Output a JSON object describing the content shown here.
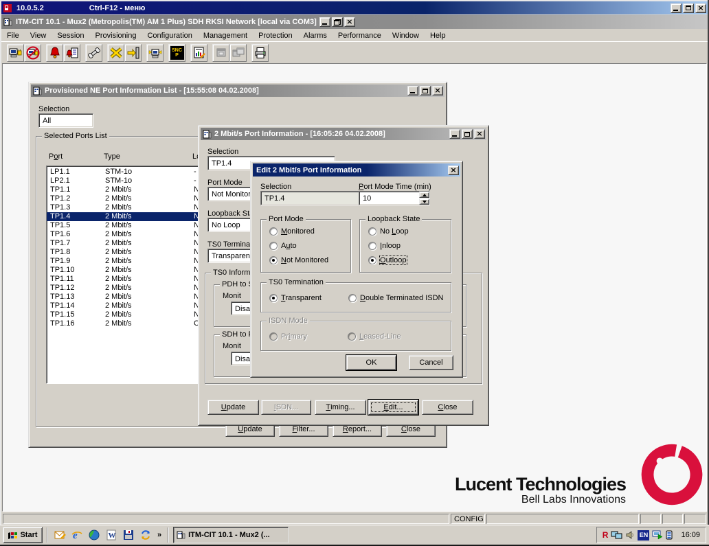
{
  "remote": {
    "ip": "10.0.5.2",
    "hint": "Ctrl-F12 - меню"
  },
  "app": {
    "title": "ITM-CIT 10.1 - Mux2 (Metropolis(TM) AM 1 Plus) SDH RKSI Network [local via COM3]"
  },
  "menu": {
    "items": [
      "File",
      "View",
      "Session",
      "Provisioning",
      "Configuration",
      "Management",
      "Protection",
      "Alarms",
      "Performance",
      "Window",
      "Help"
    ]
  },
  "toolbar": {
    "sncp_line1": "SNC",
    "sncp_line2": "P"
  },
  "window_a": {
    "title": "Provisioned NE Port Information List - [15:55:08 04.02.2008]",
    "selection_label": "Selection",
    "selection_value": "All",
    "group_label": "Selected Ports List",
    "col_port": "P&ort",
    "col_type": "Type",
    "col_state": "Lo",
    "ports": [
      {
        "port": "LP1.1",
        "type": "STM-1o",
        "state": "-"
      },
      {
        "port": "LP2.1",
        "type": "STM-1o",
        "state": "-"
      },
      {
        "port": "TP1.1",
        "type": "2 Mbit/s",
        "state": "N"
      },
      {
        "port": "TP1.2",
        "type": "2 Mbit/s",
        "state": "N"
      },
      {
        "port": "TP1.3",
        "type": "2 Mbit/s",
        "state": "N"
      },
      {
        "port": "TP1.4",
        "type": "2 Mbit/s",
        "state": "N",
        "selected": true
      },
      {
        "port": "TP1.5",
        "type": "2 Mbit/s",
        "state": "N"
      },
      {
        "port": "TP1.6",
        "type": "2 Mbit/s",
        "state": "N"
      },
      {
        "port": "TP1.7",
        "type": "2 Mbit/s",
        "state": "N"
      },
      {
        "port": "TP1.8",
        "type": "2 Mbit/s",
        "state": "N"
      },
      {
        "port": "TP1.9",
        "type": "2 Mbit/s",
        "state": "N"
      },
      {
        "port": "TP1.10",
        "type": "2 Mbit/s",
        "state": "N"
      },
      {
        "port": "TP1.11",
        "type": "2 Mbit/s",
        "state": "N"
      },
      {
        "port": "TP1.12",
        "type": "2 Mbit/s",
        "state": "N"
      },
      {
        "port": "TP1.13",
        "type": "2 Mbit/s",
        "state": "N"
      },
      {
        "port": "TP1.14",
        "type": "2 Mbit/s",
        "state": "N"
      },
      {
        "port": "TP1.15",
        "type": "2 Mbit/s",
        "state": "N"
      },
      {
        "port": "TP1.16",
        "type": "2 Mbit/s",
        "state": "C"
      }
    ],
    "buttons": {
      "update": "&Update",
      "filter": "&Filter...",
      "report": "&Report...",
      "close": "&Close"
    }
  },
  "window_b": {
    "title": "2 Mbit/s Port Information - [16:05:26 04.02.2008]",
    "selection_label": "Selection",
    "selection_value": "TP1.4",
    "port_mode_label": "Port Mode",
    "port_mode_value": "Not Monitored",
    "loopback_label": "Loopback Sta",
    "loopback_value": "No Loop",
    "ts0_label": "TS0 Terminat",
    "ts0_value": "Transparent",
    "ts0_info_group": "TS0 Inform",
    "pdh_group": "PDH to S",
    "pdh_mon_label": "Monit",
    "pdh_mon_value": "Disa",
    "sdh_group": "SDH to P",
    "sdh_mon_label": "Monit",
    "sdh_mon_value": "Disa",
    "buttons": {
      "update": "&Update",
      "isdn": "&ISDN...",
      "timing": "&Timing...",
      "edit": "&Edit...",
      "close": "&Close"
    }
  },
  "dialog": {
    "title": "Edit 2 Mbit/s Port Information",
    "selection_label": "Selection",
    "selection_value": "TP1.4",
    "pmt_label": "&Port Mode Time (min)",
    "pmt_value": "10",
    "port_mode_group": "Port Mode",
    "port_mode_options": [
      {
        "label": "&Monitored",
        "checked": false
      },
      {
        "label": "A&uto",
        "checked": false
      },
      {
        "label": "&Not Monitored",
        "checked": true
      }
    ],
    "loopback_group": "Loopback State",
    "loopback_options": [
      {
        "label": "No &Loop",
        "checked": false
      },
      {
        "label": "&Inloop",
        "checked": false
      },
      {
        "label": "&Outloop",
        "checked": true
      }
    ],
    "ts0_group": "TS0 Termination",
    "ts0_options": [
      {
        "label": "&Transparent",
        "checked": true
      },
      {
        "label": "&Double Terminated ISDN",
        "checked": false
      }
    ],
    "isdn_group": "ISDN Mode",
    "isdn_options": [
      {
        "label": "Pr&imary",
        "checked": false
      },
      {
        "label": "&Leased-Line",
        "checked": false
      }
    ],
    "ok": "OK",
    "cancel": "Cancel"
  },
  "logo": {
    "line1": "Lucent Technologies",
    "line2": "Bell Labs Innovations",
    "ring_color": "#D9103C"
  },
  "status": {
    "config": "CONFIG"
  },
  "taskbar": {
    "start": "Start",
    "chevron": "»",
    "task": "ITM-CIT 10.1 - Mux2 (...",
    "lang": "EN",
    "time": "16:09"
  },
  "colors": {
    "title_active_left": "#0A246A",
    "title_active_right": "#A6CAF0",
    "selection": "#0A246A",
    "chrome": "#D4D0C8",
    "mdi": "#F7F7F7"
  }
}
